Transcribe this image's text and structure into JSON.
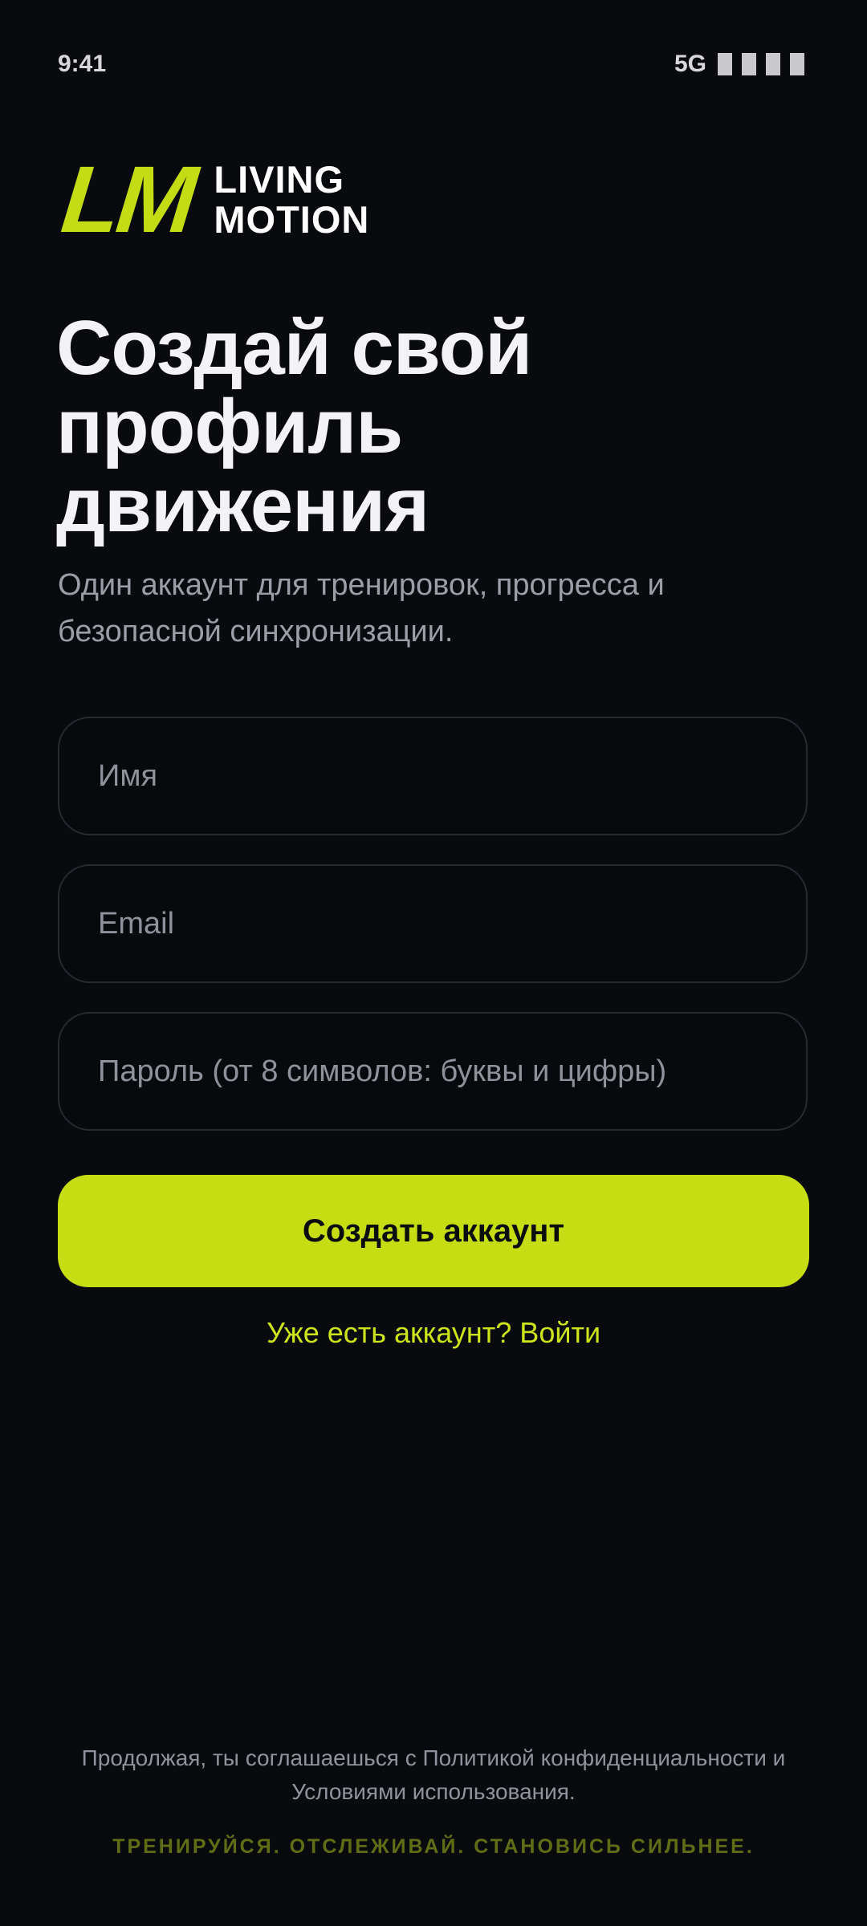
{
  "status_bar": {
    "time": "9:41",
    "network": "5G",
    "signal_icon": "signal-bars-icon"
  },
  "brand": {
    "mark": "LM",
    "name_line1": "LIVING",
    "name_line2": "MOTION",
    "accent_color": "#c5dd12"
  },
  "hero": {
    "title_line1": "Создай свой",
    "title_line2": "профиль",
    "title_line3": "движения",
    "subtitle_line1": "Один аккаунт для тренировок, прогресса и",
    "subtitle_line2": "безопасной синхронизации."
  },
  "form": {
    "name_placeholder": "Имя",
    "name_value": "",
    "email_placeholder": "Email",
    "email_value": "",
    "password_placeholder": "Пароль (от 8 символов: буквы и цифры)",
    "password_value": "",
    "submit_label": "Создать аккаунт",
    "login_link": "Уже есть аккаунт? Войти"
  },
  "footer": {
    "legal_line1": "Продолжая, ты соглашаешься с Политикой конфиденциальности и",
    "legal_line2": "Условиями использования.",
    "tagline": "ТРЕНИРУЙСЯ. ОТСЛЕЖИВАЙ. СТАНОВИСЬ СИЛЬНЕЕ."
  }
}
